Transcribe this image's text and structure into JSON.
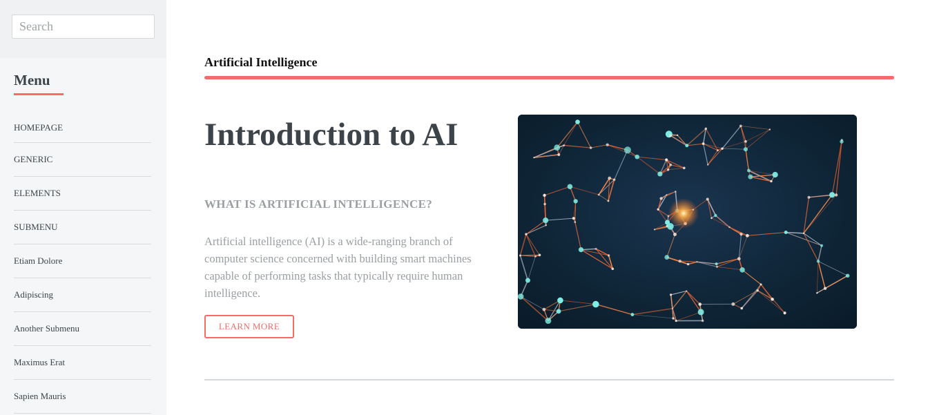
{
  "sidebar": {
    "search": {
      "placeholder": "Search",
      "value": ""
    },
    "menu_title": "Menu",
    "items": [
      {
        "label": "HOMEPAGE"
      },
      {
        "label": "GENERIC"
      },
      {
        "label": "ELEMENTS"
      },
      {
        "label": "SUBMENU"
      },
      {
        "label": "Etiam Dolore"
      },
      {
        "label": "Adipiscing"
      },
      {
        "label": "Another Submenu"
      },
      {
        "label": "Maximus Erat"
      },
      {
        "label": "Sapien Mauris"
      }
    ]
  },
  "header": {
    "title": "Artificial Intelligence",
    "accent_color": "#f56a6a"
  },
  "intro": {
    "heading": "Introduction to AI",
    "subheading": "WHAT IS ARTIFICIAL INTELLIGENCE?",
    "body": "Artificial intelligence (AI) is a wide-ranging branch of computer science concerned with building smart machines capable of performing tasks that typically require human intelligence.",
    "button_label": "LEARN MORE",
    "image": {
      "icon": "neural-network-image"
    }
  }
}
